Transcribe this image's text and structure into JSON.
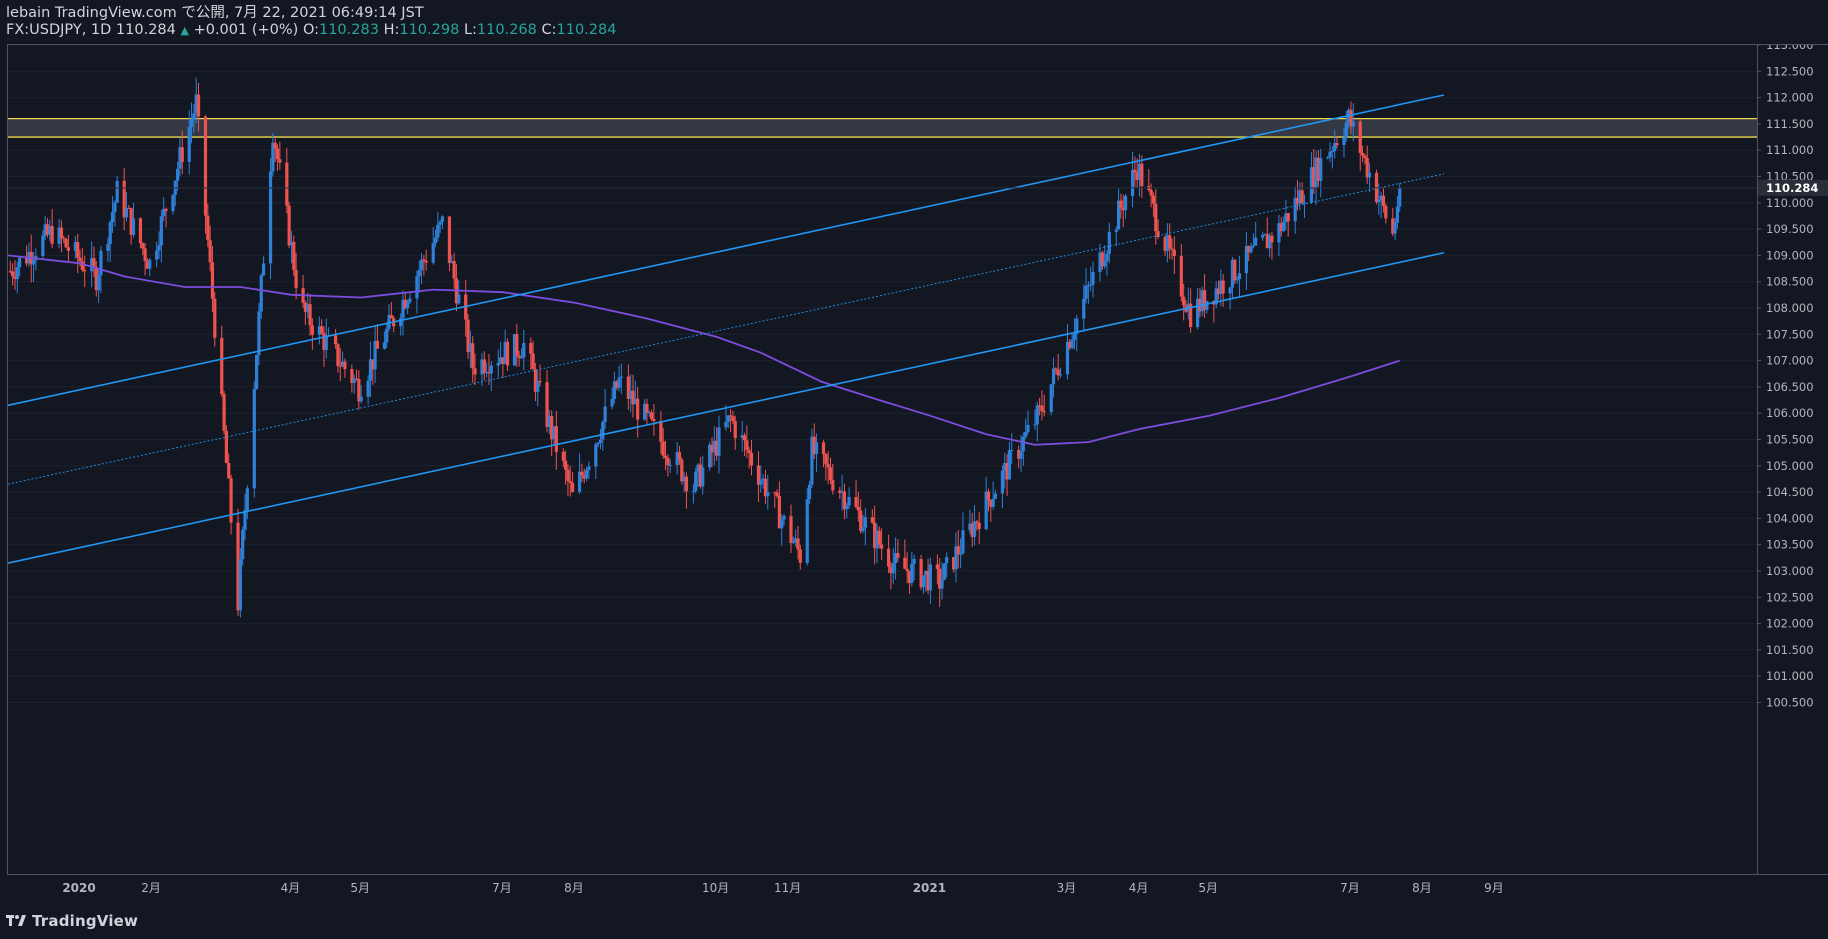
{
  "header": {
    "line1": "lebain TradingView.com で公開, 7月 22, 2021 06:49:14 JST",
    "symbol": "FX:USDJPY, 1D",
    "last": "110.284",
    "change_arrow": "▲",
    "change": "+0.001 (+0%)",
    "o_label": "O:",
    "o_value": "110.283",
    "h_label": "H:",
    "h_value": "110.298",
    "l_label": "L:",
    "l_value": "110.268",
    "c_label": "C:",
    "c_value": "110.284"
  },
  "footer": {
    "brand": "TradingView",
    "logo_icon": "tradingview-logo-icon"
  },
  "colors": {
    "background": "#131722",
    "bull": "#2f80d8",
    "bear": "#ef5350",
    "trendline": "#2196f3",
    "ma": "#7c4dde",
    "zone_border": "#f0d84a",
    "zone_fill": "#3a3e4a",
    "axis_text": "#b2b5be",
    "price_label_bg": "#2a2e39"
  },
  "chart_data": {
    "type": "candlestick",
    "symbol": "FX:USDJPY",
    "timeframe": "1D",
    "ylim": [
      100.0,
      113.5
    ],
    "y_ticks": [
      "113.500",
      "113.000",
      "112.500",
      "112.000",
      "111.500",
      "111.000",
      "110.500",
      "110.000",
      "109.500",
      "109.000",
      "108.500",
      "108.000",
      "107.500",
      "107.000",
      "106.500",
      "106.000",
      "105.500",
      "105.000",
      "104.500",
      "104.000",
      "103.500",
      "103.000",
      "102.500",
      "102.000",
      "101.500",
      "101.000",
      "100.500"
    ],
    "last_price_label": "110.284",
    "x_labels": [
      "2020",
      "2月",
      "4月",
      "5月",
      "7月",
      "8月",
      "10月",
      "11月",
      "2021",
      "3月",
      "4月",
      "5月",
      "7月",
      "8月",
      "9月"
    ],
    "x_label_dates": [
      "2020-01-01",
      "2020-02-01",
      "2020-04-01",
      "2020-05-01",
      "2020-07-01",
      "2020-08-01",
      "2020-10-01",
      "2020-11-01",
      "2021-01-01",
      "2021-03-01",
      "2021-04-01",
      "2021-05-01",
      "2021-07-01",
      "2021-08-01",
      "2021-09-01"
    ],
    "resistance_zone": {
      "top": 111.6,
      "bottom": 111.25
    },
    "channel": {
      "upper": [
        {
          "date": "2019-12-01",
          "price": 106.15
        },
        {
          "date": "2021-08-10",
          "price": 112.05
        }
      ],
      "middle": [
        {
          "date": "2019-12-01",
          "price": 104.65
        },
        {
          "date": "2021-08-10",
          "price": 110.55
        }
      ],
      "lower": [
        {
          "date": "2019-12-01",
          "price": 103.15
        },
        {
          "date": "2021-08-10",
          "price": 109.05
        }
      ]
    },
    "moving_average_200": [
      {
        "date": "2019-12-01",
        "price": 109.0
      },
      {
        "date": "2020-01-01",
        "price": 108.85
      },
      {
        "date": "2020-01-20",
        "price": 108.6
      },
      {
        "date": "2020-02-15",
        "price": 108.4
      },
      {
        "date": "2020-03-10",
        "price": 108.4
      },
      {
        "date": "2020-04-01",
        "price": 108.25
      },
      {
        "date": "2020-05-01",
        "price": 108.2
      },
      {
        "date": "2020-06-01",
        "price": 108.35
      },
      {
        "date": "2020-07-01",
        "price": 108.3
      },
      {
        "date": "2020-08-01",
        "price": 108.1
      },
      {
        "date": "2020-09-01",
        "price": 107.8
      },
      {
        "date": "2020-10-01",
        "price": 107.45
      },
      {
        "date": "2020-10-20",
        "price": 107.15
      },
      {
        "date": "2020-11-15",
        "price": 106.6
      },
      {
        "date": "2020-12-10",
        "price": 106.25
      },
      {
        "date": "2021-01-01",
        "price": 105.95
      },
      {
        "date": "2021-01-25",
        "price": 105.6
      },
      {
        "date": "2021-02-15",
        "price": 105.4
      },
      {
        "date": "2021-03-10",
        "price": 105.45
      },
      {
        "date": "2021-04-01",
        "price": 105.7
      },
      {
        "date": "2021-05-01",
        "price": 105.95
      },
      {
        "date": "2021-06-01",
        "price": 106.3
      },
      {
        "date": "2021-07-01",
        "price": 106.7
      },
      {
        "date": "2021-07-22",
        "price": 107.0
      }
    ],
    "ohlc_anchors": [
      {
        "date": "2019-12-02",
        "price": 108.7
      },
      {
        "date": "2019-12-20",
        "price": 109.45
      },
      {
        "date": "2020-01-08",
        "price": 108.6
      },
      {
        "date": "2020-01-17",
        "price": 110.2
      },
      {
        "date": "2020-01-31",
        "price": 108.85
      },
      {
        "date": "2020-02-20",
        "price": 111.9
      },
      {
        "date": "2020-03-09",
        "price": 102.4
      },
      {
        "date": "2020-03-24",
        "price": 111.4
      },
      {
        "date": "2020-04-05",
        "price": 108.0
      },
      {
        "date": "2020-04-30",
        "price": 106.5
      },
      {
        "date": "2020-06-05",
        "price": 109.6
      },
      {
        "date": "2020-06-18",
        "price": 106.9
      },
      {
        "date": "2020-07-10",
        "price": 107.3
      },
      {
        "date": "2020-07-31",
        "price": 104.4
      },
      {
        "date": "2020-08-20",
        "price": 106.6
      },
      {
        "date": "2020-09-21",
        "price": 104.6
      },
      {
        "date": "2020-10-07",
        "price": 105.9
      },
      {
        "date": "2020-11-06",
        "price": 103.3
      },
      {
        "date": "2020-11-11",
        "price": 105.3
      },
      {
        "date": "2020-12-17",
        "price": 103.1
      },
      {
        "date": "2021-01-05",
        "price": 102.8
      },
      {
        "date": "2021-02-17",
        "price": 106.0
      },
      {
        "date": "2021-03-31",
        "price": 110.7
      },
      {
        "date": "2021-04-23",
        "price": 107.9
      },
      {
        "date": "2021-05-31",
        "price": 109.5
      },
      {
        "date": "2021-06-30",
        "price": 111.6
      },
      {
        "date": "2021-07-19",
        "price": 109.4
      },
      {
        "date": "2021-07-22",
        "price": 110.28
      }
    ]
  }
}
